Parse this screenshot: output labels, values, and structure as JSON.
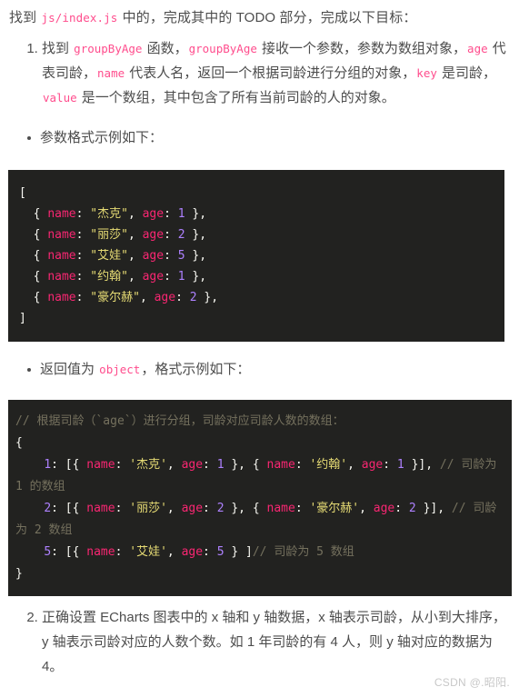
{
  "page": {
    "background": "#ffffff",
    "text_color": "#4d4d4d",
    "inline_code_color": "#ff4d8d",
    "code_bg": "#222220"
  },
  "intro": {
    "part1": "找到 ",
    "code1": "js/index.js",
    "part2": " 中的，完成其中的 TODO 部分，完成以下目标："
  },
  "task1": {
    "s1": "找到 ",
    "c1": "groupByAge",
    "s2": " 函数，",
    "c2": "groupByAge",
    "s3": " 接收一个参数，参数为数组对象，",
    "c3": "age",
    "s4": " 代表司龄，",
    "c4": "name",
    "s5": " 代表人名，返回一个根据司龄进行分组的对象，",
    "c5": "key",
    "s6": " 是司龄，",
    "c6": "value",
    "s7": " 是一个数组，其中包含了所有当前司龄的人的对象。"
  },
  "bullet1": {
    "text": "参数格式示例如下："
  },
  "bullet2": {
    "s1": "返回值为 ",
    "c1": "object",
    "s2": "，格式示例如下："
  },
  "code_block_1": {
    "language": "javascript",
    "lines": [
      [
        {
          "t": "[",
          "c": "tok-punct"
        }
      ],
      [
        {
          "t": "  { ",
          "c": "tok-punct"
        },
        {
          "t": "name",
          "c": "tok-key"
        },
        {
          "t": ": ",
          "c": "tok-punct"
        },
        {
          "t": "\"杰克\"",
          "c": "tok-str"
        },
        {
          "t": ", ",
          "c": "tok-punct"
        },
        {
          "t": "age",
          "c": "tok-key"
        },
        {
          "t": ": ",
          "c": "tok-punct"
        },
        {
          "t": "1",
          "c": "tok-num"
        },
        {
          "t": " },",
          "c": "tok-punct"
        }
      ],
      [
        {
          "t": "  { ",
          "c": "tok-punct"
        },
        {
          "t": "name",
          "c": "tok-key"
        },
        {
          "t": ": ",
          "c": "tok-punct"
        },
        {
          "t": "\"丽莎\"",
          "c": "tok-str"
        },
        {
          "t": ", ",
          "c": "tok-punct"
        },
        {
          "t": "age",
          "c": "tok-key"
        },
        {
          "t": ": ",
          "c": "tok-punct"
        },
        {
          "t": "2",
          "c": "tok-num"
        },
        {
          "t": " },",
          "c": "tok-punct"
        }
      ],
      [
        {
          "t": "  { ",
          "c": "tok-punct"
        },
        {
          "t": "name",
          "c": "tok-key"
        },
        {
          "t": ": ",
          "c": "tok-punct"
        },
        {
          "t": "\"艾娃\"",
          "c": "tok-str"
        },
        {
          "t": ", ",
          "c": "tok-punct"
        },
        {
          "t": "age",
          "c": "tok-key"
        },
        {
          "t": ": ",
          "c": "tok-punct"
        },
        {
          "t": "5",
          "c": "tok-num"
        },
        {
          "t": " },",
          "c": "tok-punct"
        }
      ],
      [
        {
          "t": "  { ",
          "c": "tok-punct"
        },
        {
          "t": "name",
          "c": "tok-key"
        },
        {
          "t": ": ",
          "c": "tok-punct"
        },
        {
          "t": "\"约翰\"",
          "c": "tok-str"
        },
        {
          "t": ", ",
          "c": "tok-punct"
        },
        {
          "t": "age",
          "c": "tok-key"
        },
        {
          "t": ": ",
          "c": "tok-punct"
        },
        {
          "t": "1",
          "c": "tok-num"
        },
        {
          "t": " },",
          "c": "tok-punct"
        }
      ],
      [
        {
          "t": "  { ",
          "c": "tok-punct"
        },
        {
          "t": "name",
          "c": "tok-key"
        },
        {
          "t": ": ",
          "c": "tok-punct"
        },
        {
          "t": "\"豪尔赫\"",
          "c": "tok-str"
        },
        {
          "t": ", ",
          "c": "tok-punct"
        },
        {
          "t": "age",
          "c": "tok-key"
        },
        {
          "t": ": ",
          "c": "tok-punct"
        },
        {
          "t": "2",
          "c": "tok-num"
        },
        {
          "t": " },",
          "c": "tok-punct"
        }
      ],
      [
        {
          "t": "]",
          "c": "tok-punct"
        }
      ]
    ]
  },
  "code_block_2": {
    "language": "javascript",
    "lines": [
      [
        {
          "t": "// 根据司龄（`age`）进行分组，司龄对应司龄人数的数组：",
          "c": "tok-comment"
        }
      ],
      [
        {
          "t": "{",
          "c": "tok-punct"
        }
      ],
      [
        {
          "t": "    ",
          "c": "tok-punct"
        },
        {
          "t": "1",
          "c": "tok-num"
        },
        {
          "t": ": [{ ",
          "c": "tok-punct"
        },
        {
          "t": "name",
          "c": "tok-key"
        },
        {
          "t": ": ",
          "c": "tok-punct"
        },
        {
          "t": "'杰克'",
          "c": "tok-str"
        },
        {
          "t": ", ",
          "c": "tok-punct"
        },
        {
          "t": "age",
          "c": "tok-key"
        },
        {
          "t": ": ",
          "c": "tok-punct"
        },
        {
          "t": "1",
          "c": "tok-num"
        },
        {
          "t": " }, { ",
          "c": "tok-punct"
        },
        {
          "t": "name",
          "c": "tok-key"
        },
        {
          "t": ": ",
          "c": "tok-punct"
        },
        {
          "t": "'约翰'",
          "c": "tok-str"
        },
        {
          "t": ", ",
          "c": "tok-punct"
        },
        {
          "t": "age",
          "c": "tok-key"
        },
        {
          "t": ": ",
          "c": "tok-punct"
        },
        {
          "t": "1",
          "c": "tok-num"
        },
        {
          "t": " }], ",
          "c": "tok-punct"
        },
        {
          "t": "// 司龄为 1 的数组",
          "c": "tok-comment"
        }
      ],
      [
        {
          "t": "    ",
          "c": "tok-punct"
        },
        {
          "t": "2",
          "c": "tok-num"
        },
        {
          "t": ": [{ ",
          "c": "tok-punct"
        },
        {
          "t": "name",
          "c": "tok-key"
        },
        {
          "t": ": ",
          "c": "tok-punct"
        },
        {
          "t": "'丽莎'",
          "c": "tok-str"
        },
        {
          "t": ", ",
          "c": "tok-punct"
        },
        {
          "t": "age",
          "c": "tok-key"
        },
        {
          "t": ": ",
          "c": "tok-punct"
        },
        {
          "t": "2",
          "c": "tok-num"
        },
        {
          "t": " }, { ",
          "c": "tok-punct"
        },
        {
          "t": "name",
          "c": "tok-key"
        },
        {
          "t": ": ",
          "c": "tok-punct"
        },
        {
          "t": "'豪尔赫'",
          "c": "tok-str"
        },
        {
          "t": ", ",
          "c": "tok-punct"
        },
        {
          "t": "age",
          "c": "tok-key"
        },
        {
          "t": ": ",
          "c": "tok-punct"
        },
        {
          "t": "2",
          "c": "tok-num"
        },
        {
          "t": " }], ",
          "c": "tok-punct"
        },
        {
          "t": "// 司龄为 2 数组",
          "c": "tok-comment"
        }
      ],
      [
        {
          "t": "    ",
          "c": "tok-punct"
        },
        {
          "t": "5",
          "c": "tok-num"
        },
        {
          "t": ": [{ ",
          "c": "tok-punct"
        },
        {
          "t": "name",
          "c": "tok-key"
        },
        {
          "t": ": ",
          "c": "tok-punct"
        },
        {
          "t": "'艾娃'",
          "c": "tok-str"
        },
        {
          "t": ", ",
          "c": "tok-punct"
        },
        {
          "t": "age",
          "c": "tok-key"
        },
        {
          "t": ": ",
          "c": "tok-punct"
        },
        {
          "t": "5",
          "c": "tok-num"
        },
        {
          "t": " } ]",
          "c": "tok-punct"
        },
        {
          "t": "// 司龄为 5 数组",
          "c": "tok-comment"
        }
      ],
      [
        {
          "t": "}",
          "c": "tok-punct"
        }
      ]
    ]
  },
  "task2": {
    "text": "正确设置 ECharts 图表中的 x 轴和 y 轴数据，x 轴表示司龄，从小到大排序，y 轴表示司龄对应的人数个数。如 1 年司龄的有 4 人，则 y 轴对应的数据为 4。"
  },
  "watermark": {
    "text": "CSDN @.昭阳."
  }
}
